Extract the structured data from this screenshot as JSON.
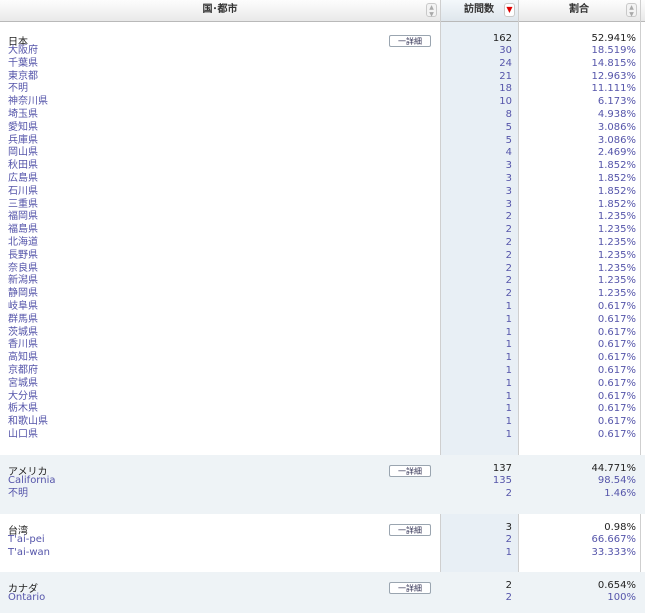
{
  "header": {
    "location_label": "国･都市",
    "visits_label": "訪問数",
    "percent_label": "割合"
  },
  "groups": [
    {
      "name": "日本",
      "visits": "162",
      "percent": "52.941%",
      "detail_label": "一詳細",
      "rows": [
        {
          "name": "大阪府",
          "visits": "30",
          "percent": "18.519%"
        },
        {
          "name": "千葉県",
          "visits": "24",
          "percent": "14.815%"
        },
        {
          "name": "東京都",
          "visits": "21",
          "percent": "12.963%"
        },
        {
          "name": "不明",
          "visits": "18",
          "percent": "11.111%"
        },
        {
          "name": "神奈川県",
          "visits": "10",
          "percent": "6.173%"
        },
        {
          "name": "埼玉県",
          "visits": "8",
          "percent": "4.938%"
        },
        {
          "name": "愛知県",
          "visits": "5",
          "percent": "3.086%"
        },
        {
          "name": "兵庫県",
          "visits": "5",
          "percent": "3.086%"
        },
        {
          "name": "岡山県",
          "visits": "4",
          "percent": "2.469%"
        },
        {
          "name": "秋田県",
          "visits": "3",
          "percent": "1.852%"
        },
        {
          "name": "広島県",
          "visits": "3",
          "percent": "1.852%"
        },
        {
          "name": "石川県",
          "visits": "3",
          "percent": "1.852%"
        },
        {
          "name": "三重県",
          "visits": "3",
          "percent": "1.852%"
        },
        {
          "name": "福岡県",
          "visits": "2",
          "percent": "1.235%"
        },
        {
          "name": "福島県",
          "visits": "2",
          "percent": "1.235%"
        },
        {
          "name": "北海道",
          "visits": "2",
          "percent": "1.235%"
        },
        {
          "name": "長野県",
          "visits": "2",
          "percent": "1.235%"
        },
        {
          "name": "奈良県",
          "visits": "2",
          "percent": "1.235%"
        },
        {
          "name": "新潟県",
          "visits": "2",
          "percent": "1.235%"
        },
        {
          "name": "静岡県",
          "visits": "2",
          "percent": "1.235%"
        },
        {
          "name": "岐阜県",
          "visits": "1",
          "percent": "0.617%"
        },
        {
          "name": "群馬県",
          "visits": "1",
          "percent": "0.617%"
        },
        {
          "name": "茨城県",
          "visits": "1",
          "percent": "0.617%"
        },
        {
          "name": "香川県",
          "visits": "1",
          "percent": "0.617%"
        },
        {
          "name": "高知県",
          "visits": "1",
          "percent": "0.617%"
        },
        {
          "name": "京都府",
          "visits": "1",
          "percent": "0.617%"
        },
        {
          "name": "宮城県",
          "visits": "1",
          "percent": "0.617%"
        },
        {
          "name": "大分県",
          "visits": "1",
          "percent": "0.617%"
        },
        {
          "name": "栃木県",
          "visits": "1",
          "percent": "0.617%"
        },
        {
          "name": "和歌山県",
          "visits": "1",
          "percent": "0.617%"
        },
        {
          "name": "山口県",
          "visits": "1",
          "percent": "0.617%"
        }
      ]
    },
    {
      "name": "アメリカ",
      "visits": "137",
      "percent": "44.771%",
      "detail_label": "一詳細",
      "rows": [
        {
          "name": "California",
          "visits": "135",
          "percent": "98.54%"
        },
        {
          "name": "不明",
          "visits": "2",
          "percent": "1.46%"
        }
      ]
    },
    {
      "name": "台湾",
      "visits": "3",
      "percent": "0.98%",
      "detail_label": "一詳細",
      "rows": [
        {
          "name": "T'ai-pei",
          "visits": "2",
          "percent": "66.667%"
        },
        {
          "name": "T'ai-wan",
          "visits": "1",
          "percent": "33.333%"
        }
      ]
    },
    {
      "name": "カナダ",
      "visits": "2",
      "percent": "0.654%",
      "detail_label": "一詳細",
      "rows": [
        {
          "name": "Ontario",
          "visits": "2",
          "percent": "100%"
        }
      ]
    }
  ]
}
